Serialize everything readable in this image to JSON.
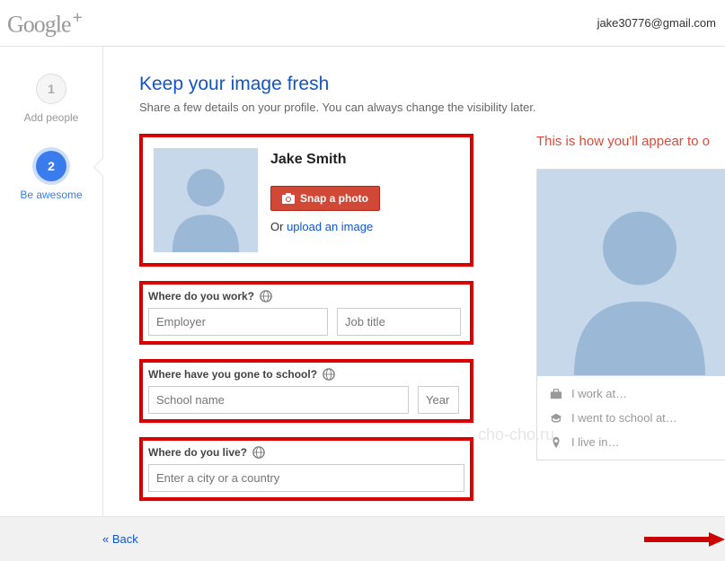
{
  "header": {
    "logo_text": "Google",
    "logo_plus": "+",
    "user_email": "jake30776@gmail.com"
  },
  "sidebar": {
    "steps": [
      {
        "num": "1",
        "label": "Add people"
      },
      {
        "num": "2",
        "label": "Be awesome"
      }
    ]
  },
  "page": {
    "title": "Keep your image fresh",
    "subtitle": "Share a few details on your profile. You can always change the visibility later."
  },
  "profile": {
    "name": "Jake Smith",
    "snap_label": "Snap a photo",
    "or_text": "Or ",
    "upload_link": "upload an image"
  },
  "sections": {
    "work": {
      "label": "Where do you work?",
      "employer_ph": "Employer",
      "jobtitle_ph": "Job title"
    },
    "school": {
      "label": "Where have you gone to school?",
      "school_ph": "School name",
      "year_ph": "Year"
    },
    "live": {
      "label": "Where do you live?",
      "city_ph": "Enter a city or a country"
    }
  },
  "preview": {
    "title": "This is how you'll appear to o",
    "meta": {
      "work": "I work at…",
      "school": "I went to school at…",
      "live": "I live in…"
    }
  },
  "footer": {
    "back": "« Back"
  },
  "watermark": "cho-cho.ru"
}
